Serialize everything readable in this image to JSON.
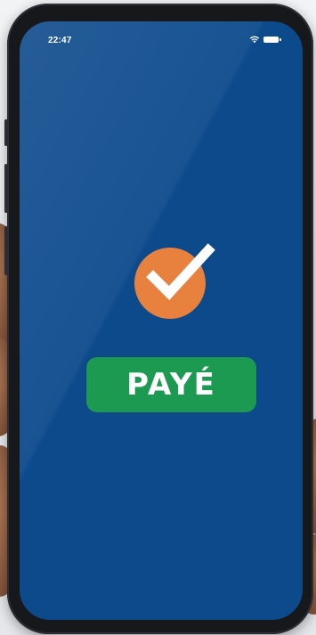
{
  "status_bar": {
    "time": "22:47",
    "wifi_icon": "wifi-icon",
    "battery_icon": "battery-icon"
  },
  "confirmation": {
    "icon": "checkmark-icon",
    "label": "PAYÉ"
  },
  "colors": {
    "screen_background": "#0d4a8c",
    "check_circle": "#e8813e",
    "badge": "#1c9a52",
    "text": "#ffffff"
  }
}
